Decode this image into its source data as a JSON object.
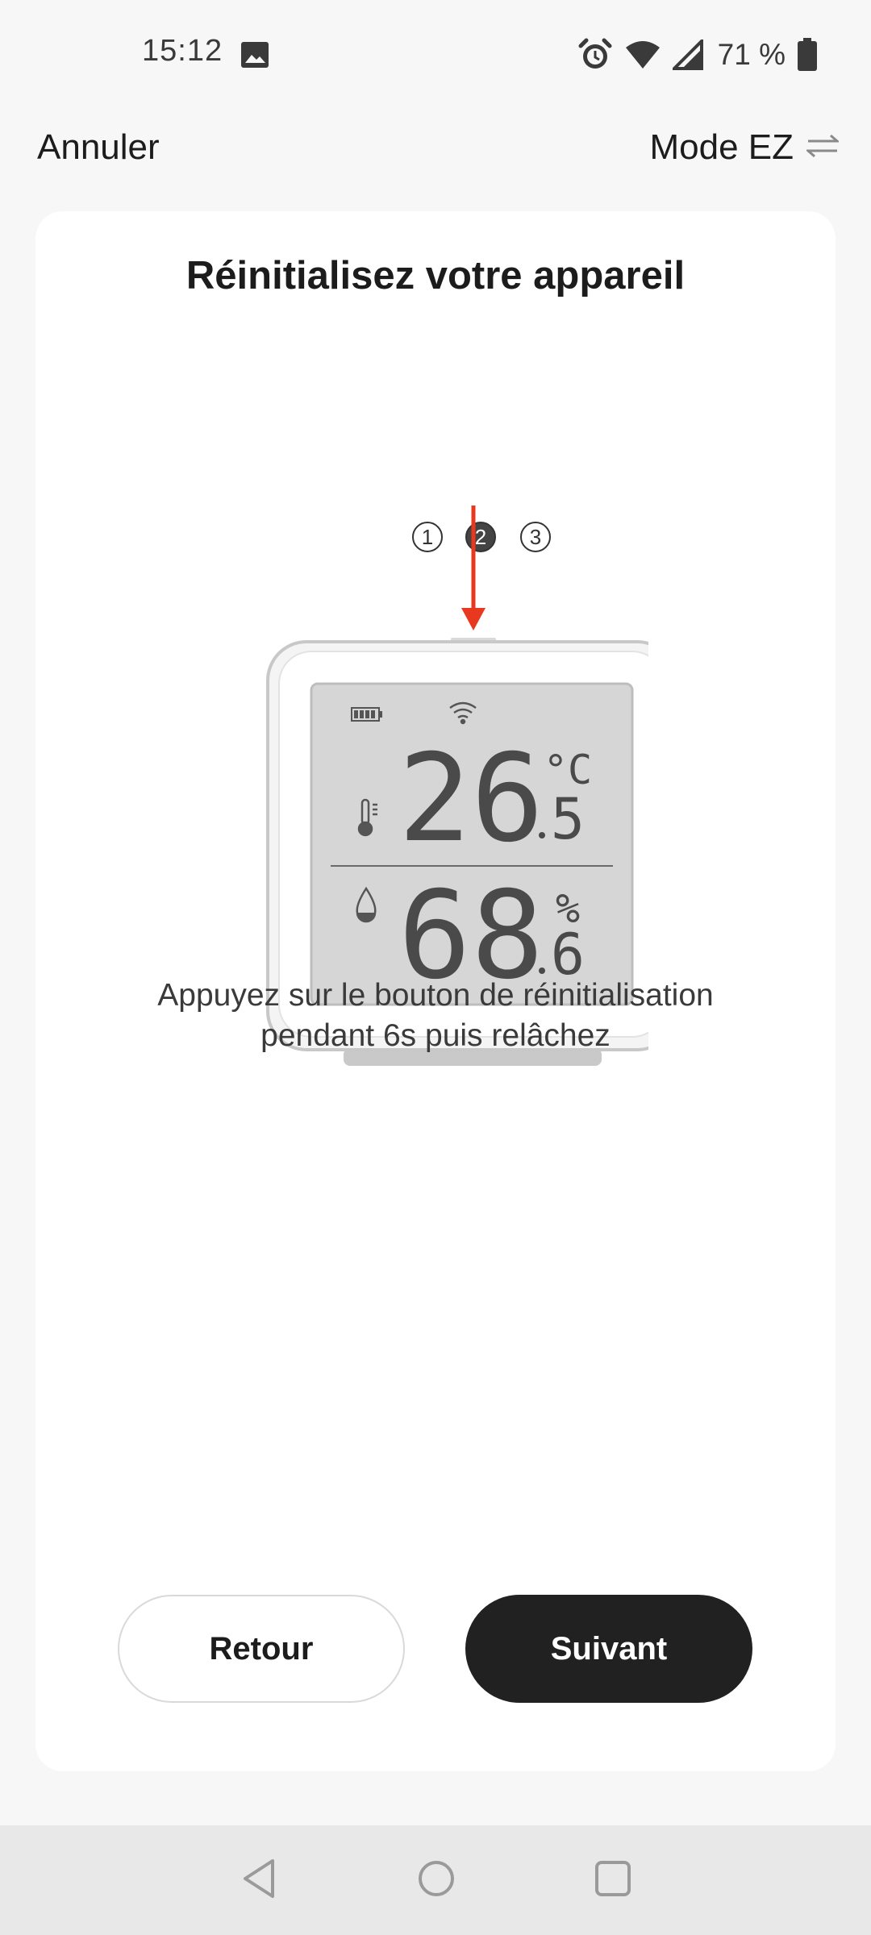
{
  "status_bar": {
    "time": "15:12",
    "battery": "71 %"
  },
  "top_bar": {
    "cancel": "Annuler",
    "mode": "Mode EZ"
  },
  "card": {
    "title": "Réinitialisez votre appareil",
    "steps": [
      "1",
      "2",
      "3"
    ],
    "active_step": 2,
    "device_display": {
      "temperature_int": "26",
      "temperature_dec": "5",
      "temperature_unit": "°C",
      "humidity_int": "68",
      "humidity_dec": "6",
      "humidity_unit": "%"
    },
    "instruction_line1": "Appuyez sur le bouton de réinitialisation",
    "instruction_line2": "pendant 6s puis relâchez",
    "back_button": "Retour",
    "next_button": "Suivant"
  },
  "colors": {
    "accent_arrow": "#e8381f",
    "primary_button": "#212121"
  },
  "icons": {
    "status": [
      "image-icon",
      "alarm-icon",
      "wifi-icon",
      "signal-icon",
      "battery-icon"
    ],
    "mode_switch": "swap-arrows-icon",
    "nav": [
      "back-triangle-icon",
      "home-circle-icon",
      "recents-square-icon"
    ]
  }
}
